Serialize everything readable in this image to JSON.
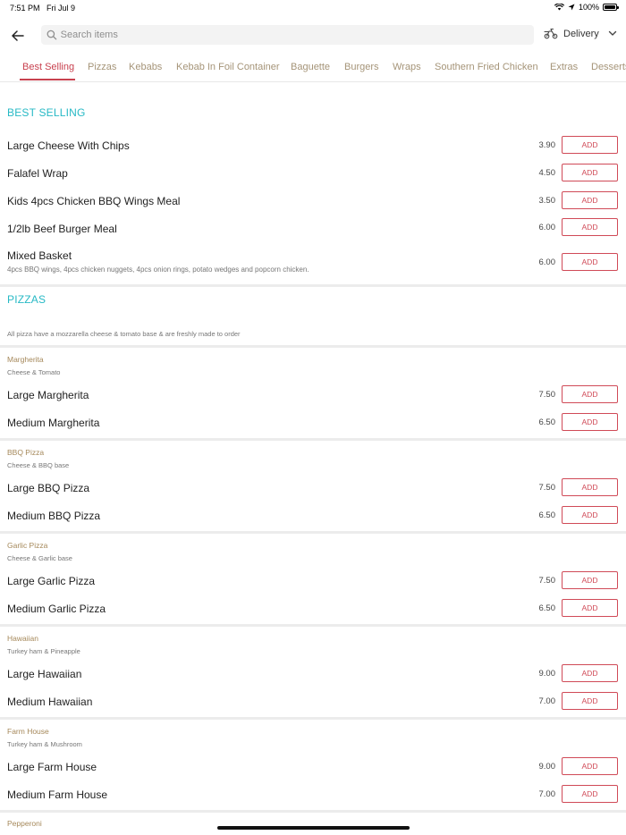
{
  "status": {
    "time": "7:51 PM",
    "date": "Fri Jul 9",
    "battery": "100%",
    "battery_level": 1.0
  },
  "search": {
    "placeholder": "Search items"
  },
  "delivery": {
    "label": "Delivery"
  },
  "tabs": [
    "Best Selling",
    "Pizzas",
    "Kebabs",
    "Kebab In Foil Container",
    "Baguette",
    "Burgers",
    "Wraps",
    "Southern Fried Chicken",
    "Extras",
    "Desserts"
  ],
  "colors": {
    "accent": "#c8414f",
    "section": "#27b9c5",
    "group": "#a5885a",
    "tab": "#a59478"
  },
  "best_selling": {
    "title": "BEST SELLING",
    "items": [
      {
        "name": "Large Cheese With Chips",
        "price": "3.90",
        "add": "ADD"
      },
      {
        "name": "Falafel Wrap",
        "price": "4.50",
        "add": "ADD"
      },
      {
        "name": "Kids 4pcs Chicken BBQ Wings Meal",
        "price": "3.50",
        "add": "ADD"
      },
      {
        "name": "1/2lb Beef Burger Meal",
        "price": "6.00",
        "add": "ADD"
      },
      {
        "name": "Mixed Basket",
        "desc": "4pcs BBQ wings, 4pcs chicken nuggets, 4pcs onion rings, potato wedges and popcorn chicken.",
        "price": "6.00",
        "add": "ADD"
      }
    ]
  },
  "pizzas": {
    "title": "PIZZAS",
    "note": "All pizza have a mozzarella cheese & tomato base & are freshly made to order",
    "groups": [
      {
        "title": "Margherita",
        "sub": "Cheese & Tomato",
        "items": [
          {
            "name": "Large Margherita",
            "price": "7.50",
            "add": "ADD"
          },
          {
            "name": "Medium Margherita",
            "price": "6.50",
            "add": "ADD"
          }
        ]
      },
      {
        "title": "BBQ Pizza",
        "sub": "Cheese & BBQ base",
        "items": [
          {
            "name": "Large BBQ Pizza",
            "price": "7.50",
            "add": "ADD"
          },
          {
            "name": "Medium BBQ Pizza",
            "price": "6.50",
            "add": "ADD"
          }
        ]
      },
      {
        "title": "Garlic Pizza",
        "sub": "Cheese & Garlic base",
        "items": [
          {
            "name": "Large Garlic Pizza",
            "price": "7.50",
            "add": "ADD"
          },
          {
            "name": "Medium Garlic Pizza",
            "price": "6.50",
            "add": "ADD"
          }
        ]
      },
      {
        "title": "Hawaiian",
        "sub": "Turkey ham & Pineapple",
        "items": [
          {
            "name": "Large Hawaiian",
            "price": "9.00",
            "add": "ADD"
          },
          {
            "name": "Medium Hawaiian",
            "price": "7.00",
            "add": "ADD"
          }
        ]
      },
      {
        "title": "Farm House",
        "sub": "Turkey ham & Mushroom",
        "items": [
          {
            "name": "Large Farm House",
            "price": "9.00",
            "add": "ADD"
          },
          {
            "name": "Medium Farm House",
            "price": "7.00",
            "add": "ADD"
          }
        ]
      },
      {
        "title": "Pepperoni",
        "sub": "",
        "items": []
      }
    ]
  }
}
